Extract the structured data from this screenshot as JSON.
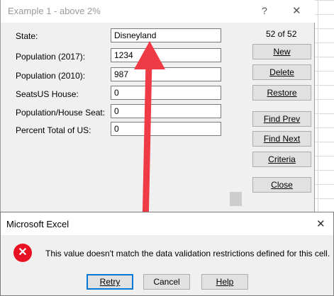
{
  "form": {
    "title": "Example 1 - above 2%",
    "help": "?",
    "close": "✕",
    "record_count": "52 of 52",
    "fields": [
      {
        "label": "State:",
        "value": "Disneyland"
      },
      {
        "label": "Population (2017):",
        "value": "1234"
      },
      {
        "label": "Population (2010):",
        "value": "987"
      },
      {
        "label": "SeatsUS House:",
        "value": "0"
      },
      {
        "label": "Population/House Seat:",
        "value": "0"
      },
      {
        "label": "Percent Total of US:",
        "value": "0"
      }
    ],
    "buttons": {
      "new": "New",
      "delete": "Delete",
      "restore": "Restore",
      "find_prev": "Find Prev",
      "find_next": "Find Next",
      "criteria": "Criteria",
      "close": "Close"
    }
  },
  "dialog": {
    "title": "Microsoft Excel",
    "close": "✕",
    "icon": "error-icon",
    "message": "This value doesn't match the data validation restrictions defined for this cell.",
    "buttons": {
      "retry": "Retry",
      "cancel": "Cancel",
      "help": "Help"
    }
  },
  "colors": {
    "arrow": "#ee3b45",
    "error": "#e81123",
    "accent": "#0078d7"
  }
}
